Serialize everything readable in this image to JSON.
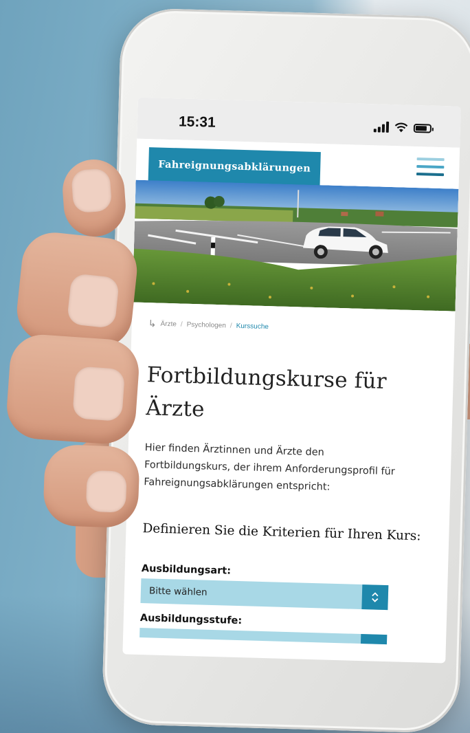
{
  "status_bar": {
    "time": "15:31"
  },
  "header": {
    "brand": "Fahreignungsabklärungen"
  },
  "breadcrumb": {
    "items": [
      "Ärzte",
      "Psychologen"
    ],
    "current": "Kurssuche",
    "separator": "/"
  },
  "main": {
    "title_line1": "Fortbildungskurse für",
    "title_line2": "Ärzte",
    "intro_line1": "Hier finden Ärztinnen und Ärzte den",
    "intro_line2": "Fortbildungskurs, der ihrem Anforderungsprofil für",
    "intro_line3": "Fahreignungsabklärungen entspricht:",
    "criteria_heading": "Definieren Sie die Kriterien für Ihren Kurs:"
  },
  "form": {
    "ausbildungsart": {
      "label": "Ausbildungsart:",
      "selected": "Bitte wählen"
    },
    "ausbildungsstufe": {
      "label": "Ausbildungsstufe:",
      "selected": ""
    }
  },
  "icons": {
    "select_chevron": "⌃⌄",
    "breadcrumb_arrow": "↳"
  },
  "colors": {
    "brand_blue": "#1f88ac",
    "select_bg": "#a8d8e6"
  }
}
